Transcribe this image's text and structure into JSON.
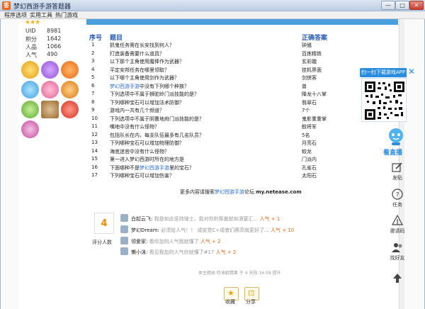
{
  "window": {
    "title": "梦幻西游手游答题器",
    "icon_glyph": "答",
    "min_glyph": "—",
    "max_glyph": "□",
    "close_glyph": "✕"
  },
  "menu": [
    "程序选项",
    "实用工具",
    "热门游戏"
  ],
  "profile": {
    "stars": "★★★",
    "stats": [
      {
        "label": "UID",
        "value": "8981"
      },
      {
        "label": "积分",
        "value": "1642"
      },
      {
        "label": "人品",
        "value": "1066"
      },
      {
        "label": "人气",
        "value": "490"
      }
    ]
  },
  "qa": {
    "header": {
      "num": "序号",
      "question": "题目",
      "answer": "正确答案"
    },
    "rows": [
      {
        "num": "1",
        "q": "抓鬼任务需在长安找到何人？",
        "a": "钟馗"
      },
      {
        "num": "2",
        "q": "打造装备需要什么道具？",
        "a": "百炼精铁"
      },
      {
        "num": "3",
        "q": "以下那个主角使用魔棒作为武器？",
        "a": "玄彩娥"
      },
      {
        "num": "4",
        "q": "平定安邦任务在哪里领取？",
        "a": "挂机界面"
      },
      {
        "num": "5",
        "q": "以下哪个主角使用剑作为武器？",
        "a": "剑侠客"
      },
      {
        "num": "6",
        "q_pre": "",
        "q_hl": "梦幻西游手游",
        "q_post": "中没有下列哪个种族？",
        "a": "兽"
      },
      {
        "num": "7",
        "q": "下列选项中不属于狮驼岭门派技能的是？",
        "a": "降龙十八掌"
      },
      {
        "num": "8",
        "q": "下列哪种宝石可以增加法术防御？",
        "a": "翡翠石"
      },
      {
        "num": "9",
        "q": "游戏内一共有几个频道？",
        "a": "7个"
      },
      {
        "num": "10",
        "q": "下列选项中不属于阴曹地府门派技能的是？",
        "a": "鬼影重重掌"
      },
      {
        "num": "11",
        "q": "嘴地中没有什么怪物？",
        "a": "鲛将军"
      },
      {
        "num": "12",
        "q": "包括队长在内，每支队伍最多有几名队员？",
        "a": "5名"
      },
      {
        "num": "13",
        "q": "下列哪种宝石可以增加物理防御？",
        "a": "月亮石"
      },
      {
        "num": "14",
        "q": "海底迷宫中没有什么怪物？",
        "a": "蛟龙"
      },
      {
        "num": "15",
        "q": "第一进入梦幻西游时所在的地方是",
        "a": "门派内"
      },
      {
        "num": "16",
        "q_pre": "下面哪种不是",
        "q_hl": "梦幻西游手游",
        "q_post": "里的宝石？",
        "a": "孔雀石"
      },
      {
        "num": "17",
        "q": "下列哪种宝石可以增加伤害？",
        "a": "太阳石"
      }
    ]
  },
  "more": {
    "pre": "更多内容请搜索",
    "hl": "梦幻西游手游",
    "mid": "论坛:",
    "url": "my.netease.com"
  },
  "rating": {
    "score": "4",
    "label": "评分人数"
  },
  "comments": [
    {
      "name": "白起云飞:",
      "text": "我是如此坚持骑士，我对你的祭奠就如酒宴汇...",
      "pop": "人气 + 1"
    },
    {
      "name": "梦幻Dream:",
      "text": "必须给人气！！ 成皮党C+成者们赛高就更好了...",
      "pop": "人气 + 10"
    },
    {
      "name": "领爱家:",
      "text": "看你加的人气我就懂了",
      "pop": "人气 + 2"
    },
    {
      "name": "懒小沫:",
      "text": "看见我加的人气你就懂了#17",
      "pop": "人气 + 2"
    }
  ],
  "footer": {
    "meta": "本主题由 叻油姐精果 于 4 天前 16:58 提升"
  },
  "actions": [
    {
      "glyph": "★",
      "label": "收藏"
    },
    {
      "glyph": "⊡",
      "label": "分享"
    }
  ],
  "qr": {
    "title": "扫一扫下载游戏APP",
    "close_glyph": "✕"
  },
  "side": {
    "watch": "看直播",
    "items": [
      "发贴",
      "任务",
      "邀请码",
      "找好友"
    ]
  },
  "colors": {
    "accent": "#2a8de0",
    "link": "#2a6fd1",
    "popularity": "#e66a1a",
    "score": "#f08a00",
    "strip": "#4a9fde"
  }
}
